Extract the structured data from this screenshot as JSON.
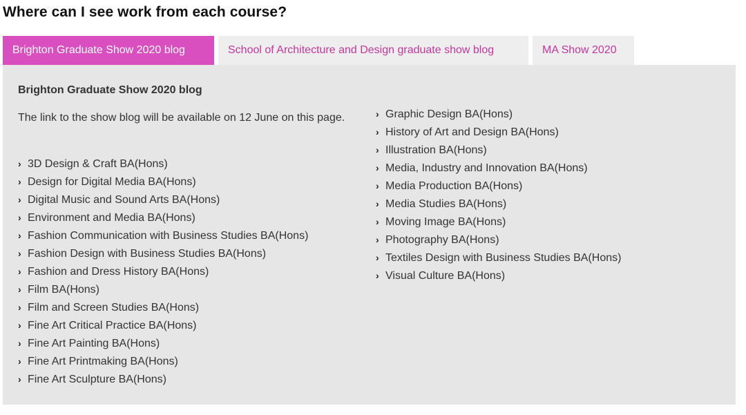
{
  "heading": "Where can I see work from each course?",
  "tabs": [
    {
      "label": "Brighton Graduate Show 2020 blog",
      "active": true
    },
    {
      "label": "School of Architecture and Design graduate show blog",
      "active": false
    },
    {
      "label": "MA Show 2020",
      "active": false
    }
  ],
  "panel": {
    "title": "Brighton Graduate Show 2020 blog",
    "intro": "The link to the show blog will be available on 12 June on this page.",
    "chevron": "›",
    "left_courses": [
      "3D Design & Craft BA(Hons)",
      "Design for Digital Media BA(Hons)",
      "Digital Music and Sound Arts BA(Hons)",
      "Environment and Media BA(Hons)",
      "Fashion Communication with Business Studies BA(Hons)",
      "Fashion Design with Business Studies BA(Hons)",
      "Fashion and Dress History BA(Hons)",
      "Film BA(Hons)",
      "Film and Screen Studies BA(Hons)",
      "Fine Art Critical Practice BA(Hons)",
      "Fine Art Painting BA(Hons)",
      "Fine Art Printmaking BA(Hons)",
      "Fine Art Sculpture BA(Hons)"
    ],
    "right_courses": [
      "Graphic Design BA(Hons)",
      "History of Art and Design BA(Hons)",
      "Illustration BA(Hons)",
      "Media, Industry and Innovation BA(Hons)",
      "Media Production BA(Hons)",
      "Media Studies BA(Hons)",
      "Moving Image BA(Hons)",
      "Photography BA(Hons)",
      "Textiles Design with Business Studies BA(Hons)",
      "Visual Culture BA(Hons)"
    ]
  },
  "colors": {
    "accent": "#d94fc0",
    "tab_text": "#c2379e",
    "tab_bg": "#eeeeee",
    "panel_bg": "#e6e6e6"
  },
  "icons": {
    "list_bullet": "chevron-right-icon"
  }
}
